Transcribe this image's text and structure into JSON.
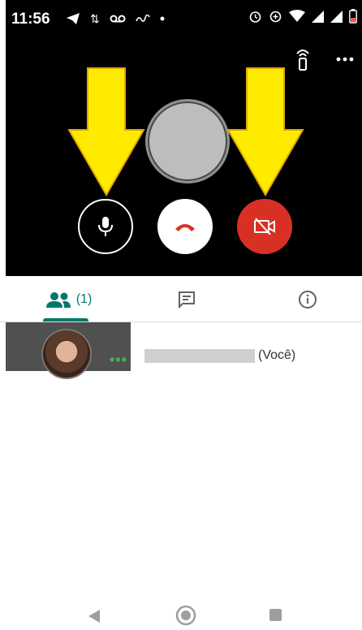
{
  "status_bar": {
    "time": "11:56",
    "icons_left": [
      "telegram-icon",
      "data-transfer-icon",
      "voicemail-icon",
      "notification-icon",
      "dot-icon"
    ],
    "icons_right": [
      "alarm-icon",
      "data-saver-icon",
      "wifi-icon",
      "signal-icon",
      "signal-icon",
      "battery-low-icon"
    ],
    "battery_color": "#ff5252"
  },
  "call": {
    "background": "#000000",
    "self_avatar_color": "#bdbdbd",
    "arrow_color": "#ffeb00",
    "controls": {
      "mic": {
        "icon": "microphone-icon"
      },
      "end_call": {
        "icon": "hang-up-icon",
        "color": "#d93025"
      },
      "camera": {
        "icon": "camera-off-icon",
        "background": "#d93025"
      }
    }
  },
  "tabs": {
    "people_count": "(1)",
    "accent": "#00796b",
    "items": [
      "people-icon",
      "chat-icon",
      "info-icon"
    ]
  },
  "participants": [
    {
      "suffix": "(Você)"
    }
  ]
}
